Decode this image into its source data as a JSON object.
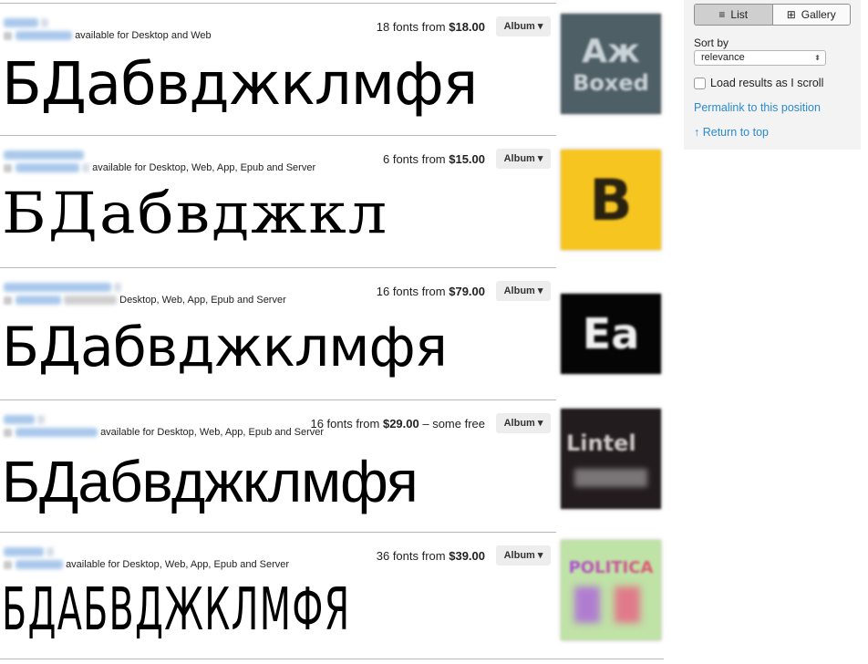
{
  "results": [
    {
      "availability": "available for Desktop and Web",
      "price_prefix": "18 fonts from ",
      "price": "$18.00",
      "price_suffix": "",
      "album_label": "Album ▾",
      "sample_text": "БДабвджклмфя",
      "thumb": {
        "bg": "#4f5f66",
        "line1": "Аж",
        "line2": "Boxed",
        "fg": "#c9d2d6"
      }
    },
    {
      "availability": "available for Desktop, Web, App, Epub and Server",
      "price_prefix": "6 fonts from ",
      "price": "$15.00",
      "price_suffix": "",
      "album_label": "Album ▾",
      "sample_text": "БДабвджкл",
      "thumb": {
        "bg": "#f7c51f",
        "line1": "B",
        "line2": "",
        "fg": "#2a2210"
      }
    },
    {
      "availability": "Desktop, Web, App, Epub and Server",
      "price_prefix": "16 fonts from ",
      "price": "$79.00",
      "price_suffix": "",
      "album_label": "Album ▾",
      "sample_text": "БДабвджклмфя",
      "thumb": {
        "bg": "#050505",
        "line1": "Ea",
        "line2": "",
        "fg": "#f0f0f0"
      }
    },
    {
      "availability": "available for Desktop, Web, App, Epub and Server",
      "price_prefix": "16 fonts from ",
      "price": "$29.00",
      "price_suffix": " – some free",
      "album_label": "Album ▾",
      "sample_text": "БДабвджклмфя",
      "thumb": {
        "bg": "#231c1e",
        "line1": "Lintel",
        "line2": "",
        "fg": "#cfcaca"
      }
    },
    {
      "availability": "available for Desktop, Web, App, Epub and Server",
      "price_prefix": "36 fonts from ",
      "price": "$39.00",
      "price_suffix": "",
      "album_label": "Album ▾",
      "sample_text": "БДАБВДЖКЛМФЯ",
      "thumb": {
        "bg": "#bfe2a6",
        "line1": "POLITICA",
        "line2": "",
        "fg": "#a84fd8"
      }
    }
  ],
  "panel": {
    "view_list_label": "List",
    "view_gallery_label": "Gallery",
    "view_list_icon": "≡",
    "view_gallery_icon": "⊞",
    "sort_label": "Sort by",
    "sort_value": "relevance",
    "sort_arrows": "⬍",
    "scroll_option_label": "Load results as I scroll",
    "permalink_label": "Permalink to this position",
    "return_top_label": "↑ Return to top"
  },
  "colors": {
    "link": "#2b8ad0",
    "panel_bg": "#f3f3f3",
    "album_button_bg": "#ededed"
  }
}
